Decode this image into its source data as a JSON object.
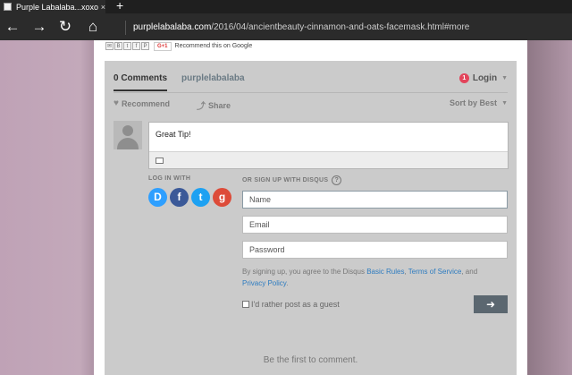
{
  "browser": {
    "tab_title": "Purple Labalaba...xoxo:",
    "tab_close": "×",
    "new_tab": "+",
    "back": "←",
    "forward": "→",
    "refresh": "↻",
    "home": "⌂",
    "url_host": "purplelabalaba.com",
    "url_path": "/2016/04/ancientbeauty-cinnamon-and-oats-facemask.html#more"
  },
  "share_bar": {
    "icons": [
      "email-icon",
      "blogger-icon",
      "twitter-icon",
      "facebook-icon",
      "pinterest-icon"
    ],
    "gplus_label": "G+1",
    "recommend_google": "Recommend this on Google"
  },
  "disqus": {
    "tab_comments": "0 Comments",
    "tab_site": "purplelabalaba",
    "notification_count": "1",
    "login": "Login",
    "recommend": "Recommend",
    "share": "Share",
    "sort": "Sort by Best",
    "comment_text": "Great Tip!",
    "login_with": "LOG IN WITH",
    "signup_with": "OR SIGN UP WITH DISQUS",
    "help": "?",
    "social": {
      "disqus": "D",
      "facebook": "f",
      "twitter": "t",
      "google": "g"
    },
    "name_placeholder": "Name",
    "email_placeholder": "Email",
    "password_placeholder": "Password",
    "terms_prefix": "By signing up, you agree to the Disqus ",
    "basic_rules": "Basic Rules",
    "comma": ", ",
    "terms_of_service": "Terms of Service",
    "and": ", and",
    "privacy_policy": "Privacy Policy",
    "period": ".",
    "guest_label": "I'd rather post as a guest",
    "submit_arrow": "➜",
    "first_comment": "Be the first to comment."
  },
  "colors": {
    "chrome_bg": "#2b2b2b",
    "disqus_panel": "#cbcbcb",
    "link": "#2e7cc0",
    "notification": "#e3445b",
    "disqus_blue": "#2e9fff",
    "facebook_blue": "#3b5998",
    "twitter_blue": "#1da1f2",
    "google_red": "#dd4b39",
    "submit_bg": "#5b6770"
  }
}
